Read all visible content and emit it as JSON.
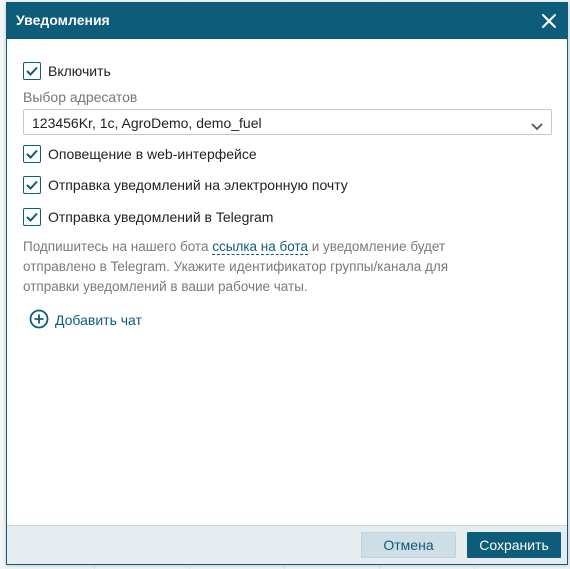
{
  "dialog": {
    "title": "Уведомления",
    "close_icon": "close-icon"
  },
  "enable": {
    "label": "Включить",
    "checked": true
  },
  "recipients": {
    "label": "Выбор адресатов",
    "value": "123456Kr, 1c, AgroDemo, demo_fuel"
  },
  "options": [
    {
      "label": "Оповещение в web-интерфейсе",
      "checked": true
    },
    {
      "label": "Отправка уведомлений на электронную почту",
      "checked": true
    },
    {
      "label": "Отправка уведомлений в Telegram",
      "checked": true
    }
  ],
  "hint": {
    "before": "Подпишитесь на нашего бота ",
    "link": "ссылка на бота",
    "after": " и уведомление будет отправлено в Telegram. Укажите идентификатор группы/канала для отправки уведомлений в ваши рабочие чаты."
  },
  "add_chat": {
    "label": "Добавить чат",
    "icon": "plus-circle-icon"
  },
  "footer": {
    "cancel": "Отмена",
    "save": "Сохранить"
  },
  "colors": {
    "accent": "#0d5c79",
    "footer_bg": "#e6edf1",
    "cancel_bg": "#cfdde6"
  }
}
